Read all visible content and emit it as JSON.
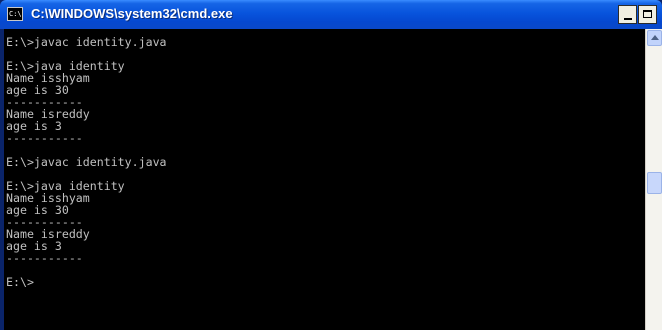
{
  "window": {
    "title": "C:\\WINDOWS\\system32\\cmd.exe",
    "icon_label": "C:\\"
  },
  "controls": {
    "minimize_icon": "minimize-icon",
    "maximize_icon": "maximize-icon"
  },
  "console": {
    "lines": [
      "E:\\>javac identity.java",
      "",
      "E:\\>java identity",
      "Name isshyam",
      "age is 30",
      "-----------",
      "Name isreddy",
      "age is 3",
      "-----------",
      "",
      "E:\\>javac identity.java",
      "",
      "E:\\>java identity",
      "Name isshyam",
      "age is 30",
      "-----------",
      "Name isreddy",
      "age is 3",
      "-----------",
      "",
      "E:\\>"
    ]
  },
  "colors": {
    "titlebar": "#0854dd",
    "console_bg": "#000000",
    "console_fg": "#c0c0c0"
  }
}
